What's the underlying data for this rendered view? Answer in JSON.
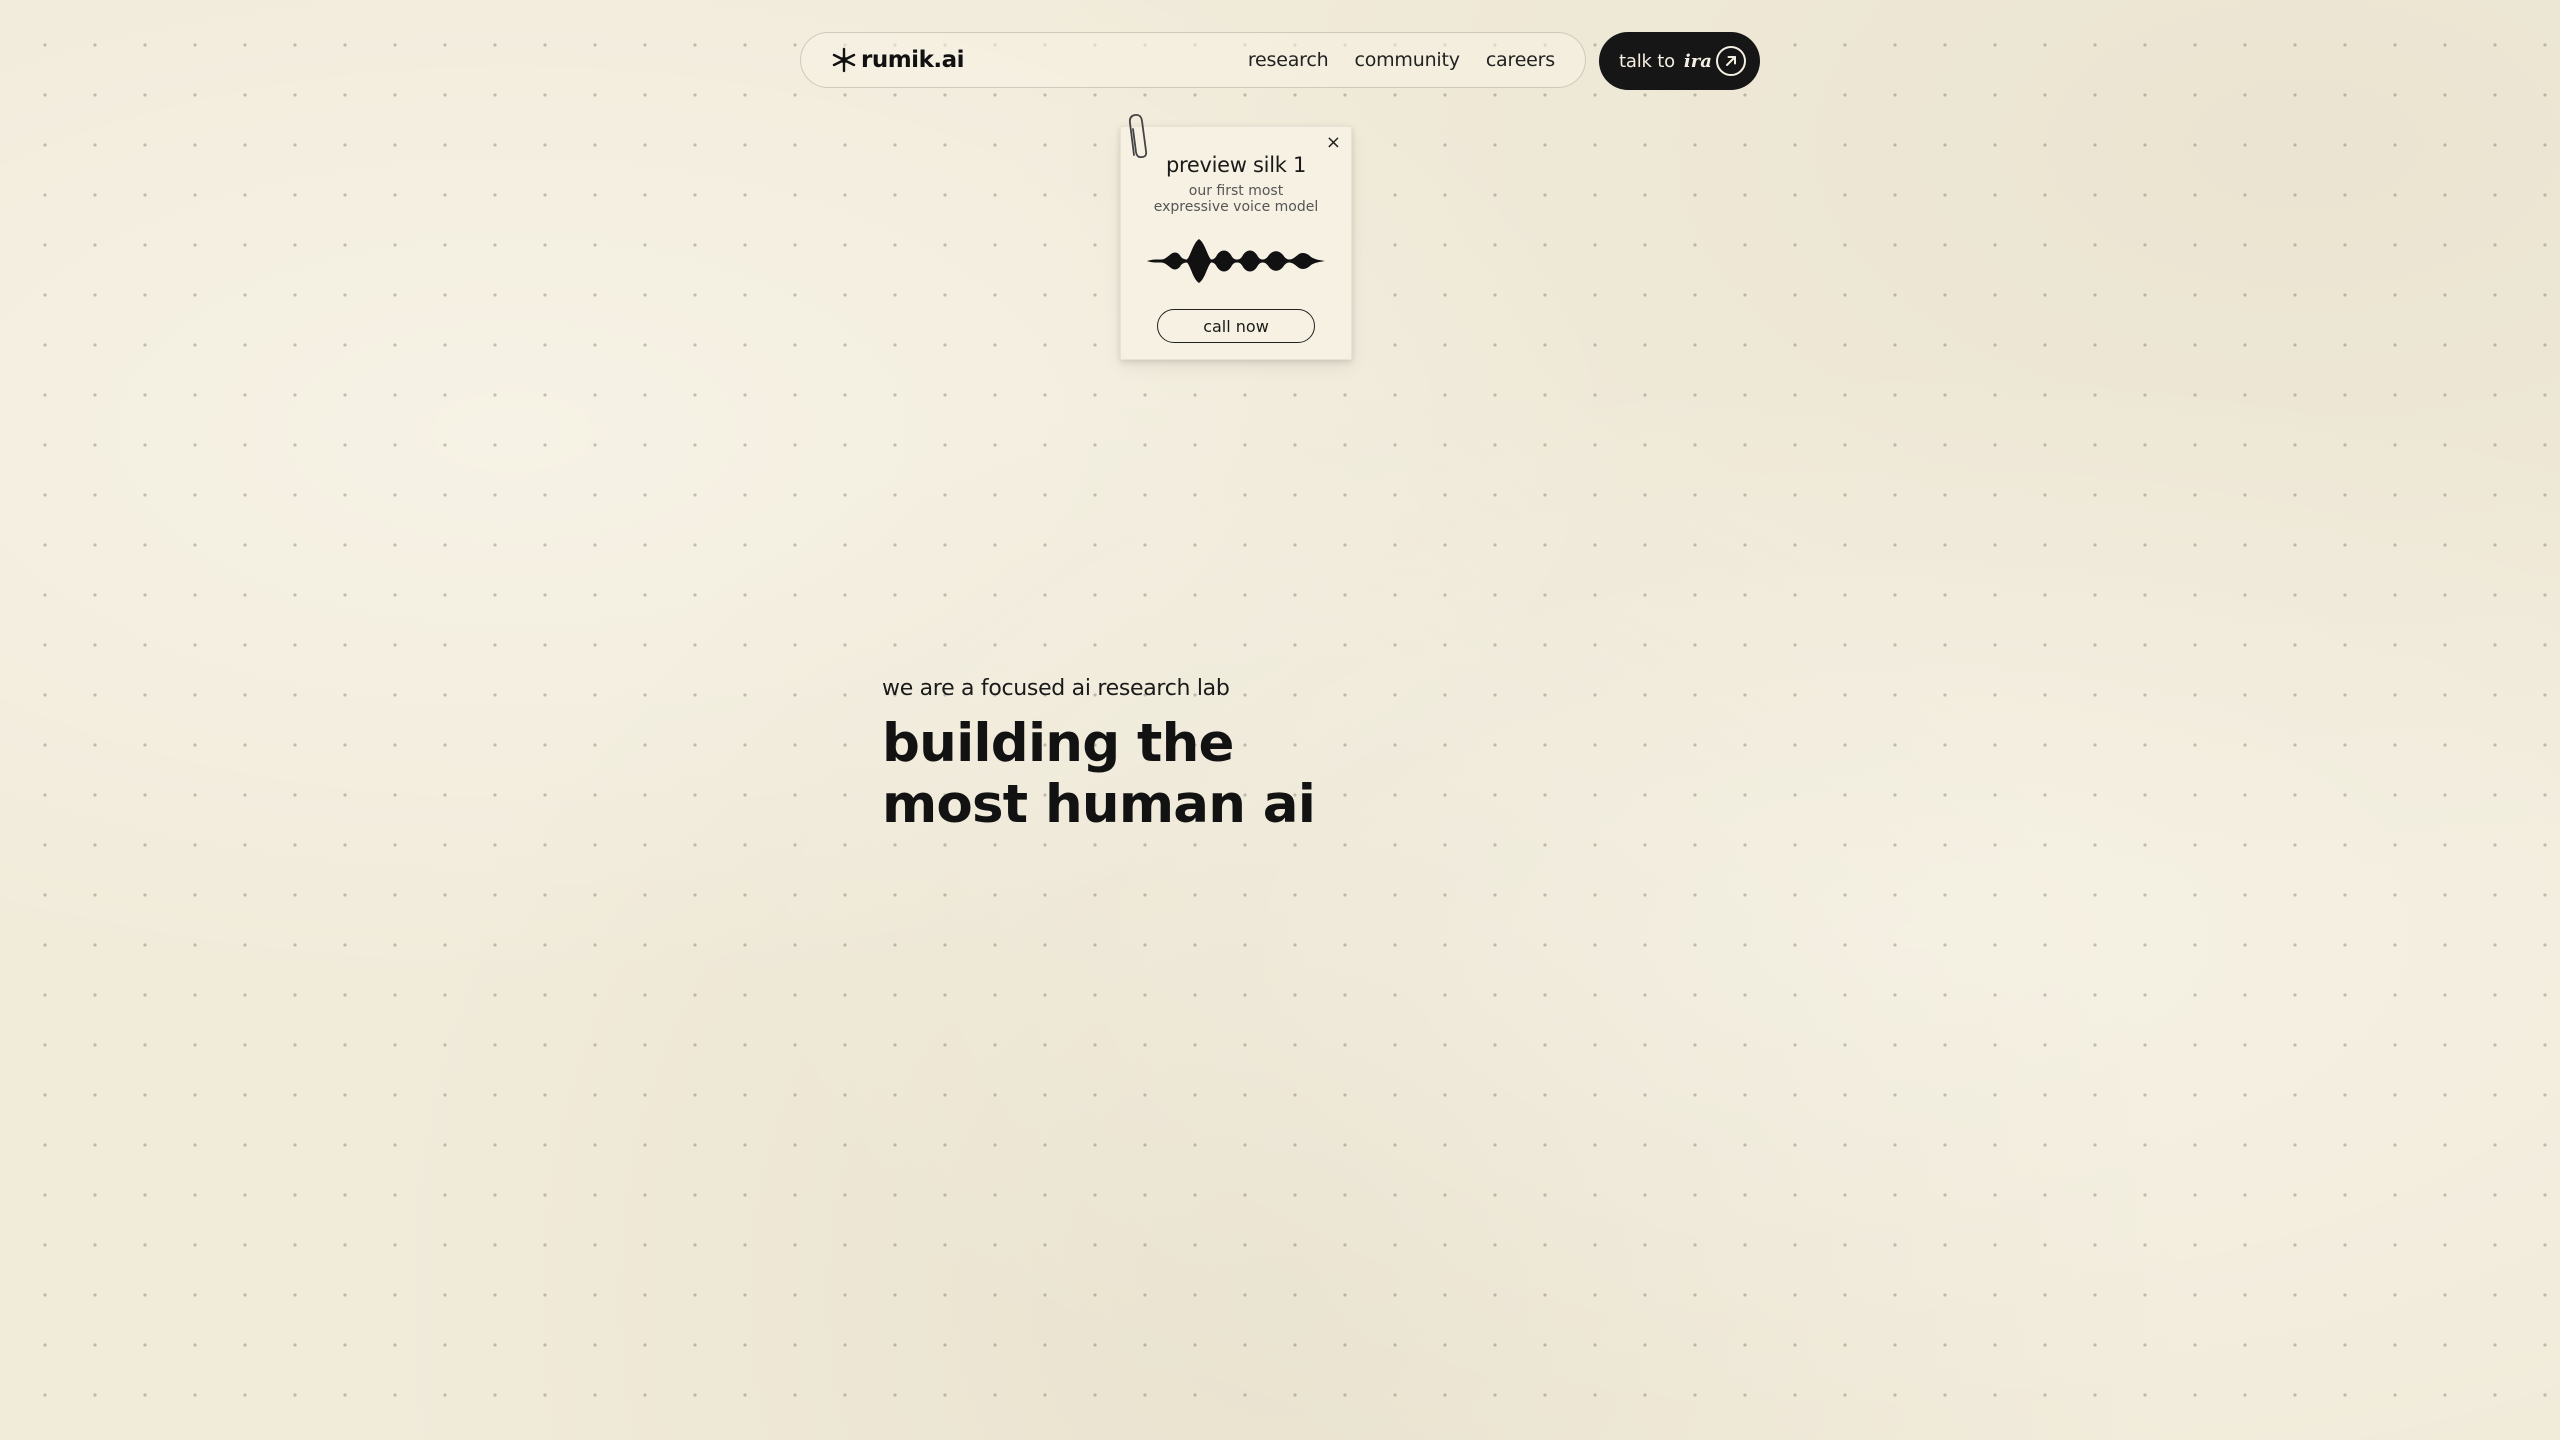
{
  "nav": {
    "logo_text": "rumik.ai",
    "logo_icon": "asterisk-star-icon",
    "links": [
      {
        "label": "research"
      },
      {
        "label": "community"
      },
      {
        "label": "careers"
      }
    ]
  },
  "cta": {
    "label": "talk to",
    "name": "ira",
    "icon": "arrow-up-right-circle-icon"
  },
  "note": {
    "title": "preview silk 1",
    "subtitle": "our first most expressive voice model",
    "button_label": "call now",
    "close_label": "×"
  },
  "hero": {
    "tagline": "we are a focused ai research lab",
    "headline_line1": "building the",
    "headline_line2": "most human ai"
  },
  "colors": {
    "background": "#f1ebda",
    "text": "#141414",
    "button_dark": "#161616",
    "button_text": "#f4efe2"
  }
}
